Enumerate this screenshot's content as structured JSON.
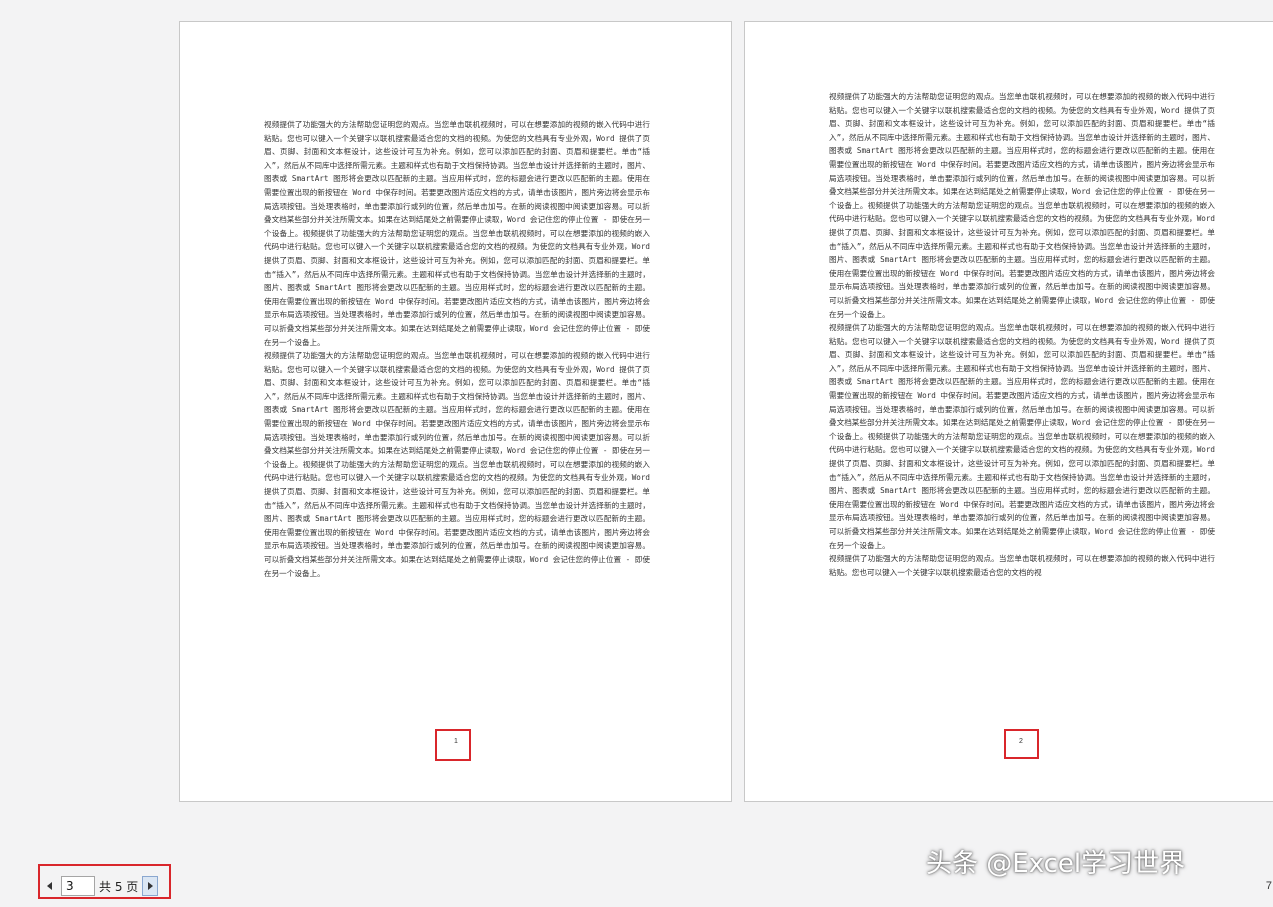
{
  "document": {
    "pages": [
      {
        "number": "1",
        "paragraphs": [
          "视频提供了功能强大的方法帮助您证明您的观点。当您单击联机视频时，可以在想要添加的视频的嵌入代码中进行粘贴。您也可以键入一个关键字以联机搜索最适合您的文档的视频。为使您的文档具有专业外观，Word 提供了页眉、页脚、封面和文本框设计，这些设计可互为补充。例如，您可以添加匹配的封面、页眉和提要栏。单击“插入”，然后从不同库中选择所需元素。主题和样式也有助于文档保持协调。当您单击设计并选择新的主题时，图片、图表或 SmartArt 图形将会更改以匹配新的主题。当应用样式时，您的标题会进行更改以匹配新的主题。使用在需要位置出现的新按钮在 Word 中保存时间。若要更改图片适应文档的方式，请单击该图片，图片旁边将会显示布局选项按钮。当处理表格时，单击要添加行或列的位置，然后单击加号。在新的阅读视图中阅读更加容易。可以折叠文档某些部分并关注所需文本。如果在达到结尾处之前需要停止读取，Word 会记住您的停止位置 - 即使在另一个设备上。视频提供了功能强大的方法帮助您证明您的观点。当您单击联机视频时，可以在想要添加的视频的嵌入代码中进行粘贴。您也可以键入一个关键字以联机搜索最适合您的文档的视频。为使您的文档具有专业外观，Word 提供了页眉、页脚、封面和文本框设计，这些设计可互为补充。例如，您可以添加匹配的封面、页眉和提要栏。单击“插入”，然后从不同库中选择所需元素。主题和样式也有助于文档保持协调。当您单击设计并选择新的主题时，图片、图表或 SmartArt 图形将会更改以匹配新的主题。当应用样式时，您的标题会进行更改以匹配新的主题。使用在需要位置出现的新按钮在 Word 中保存时间。若要更改图片适应文档的方式，请单击该图片，图片旁边将会显示布局选项按钮。当处理表格时，单击要添加行或列的位置，然后单击加号。在新的阅读视图中阅读更加容易。可以折叠文档某些部分并关注所需文本。如果在达到结尾处之前需要停止读取，Word 会记住您的停止位置 - 即使在另一个设备上。",
          "视频提供了功能强大的方法帮助您证明您的观点。当您单击联机视频时，可以在想要添加的视频的嵌入代码中进行粘贴。您也可以键入一个关键字以联机搜索最适合您的文档的视频。为使您的文档具有专业外观，Word 提供了页眉、页脚、封面和文本框设计，这些设计可互为补充。例如，您可以添加匹配的封面、页眉和提要栏。单击“插入”，然后从不同库中选择所需元素。主题和样式也有助于文档保持协调。当您单击设计并选择新的主题时，图片、图表或 SmartArt 图形将会更改以匹配新的主题。当应用样式时，您的标题会进行更改以匹配新的主题。使用在需要位置出现的新按钮在 Word 中保存时间。若要更改图片适应文档的方式，请单击该图片，图片旁边将会显示布局选项按钮。当处理表格时，单击要添加行或列的位置，然后单击加号。在新的阅读视图中阅读更加容易。可以折叠文档某些部分并关注所需文本。如果在达到结尾处之前需要停止读取，Word 会记住您的停止位置 - 即使在另一个设备上。视频提供了功能强大的方法帮助您证明您的观点。当您单击联机视频时，可以在想要添加的视频的嵌入代码中进行粘贴。您也可以键入一个关键字以联机搜索最适合您的文档的视频。为使您的文档具有专业外观，Word 提供了页眉、页脚、封面和文本框设计，这些设计可互为补充。例如，您可以添加匹配的封面、页眉和提要栏。单击“插入”，然后从不同库中选择所需元素。主题和样式也有助于文档保持协调。当您单击设计并选择新的主题时，图片、图表或 SmartArt 图形将会更改以匹配新的主题。当应用样式时，您的标题会进行更改以匹配新的主题。使用在需要位置出现的新按钮在 Word 中保存时间。若要更改图片适应文档的方式，请单击该图片，图片旁边将会显示布局选项按钮。当处理表格时，单击要添加行或列的位置，然后单击加号。在新的阅读视图中阅读更加容易。可以折叠文档某些部分并关注所需文本。如果在达到结尾处之前需要停止读取，Word 会记住您的停止位置 - 即使在另一个设备上。"
        ]
      },
      {
        "number": "2",
        "paragraphs": [
          "视频提供了功能强大的方法帮助您证明您的观点。当您单击联机视频时，可以在想要添加的视频的嵌入代码中进行粘贴。您也可以键入一个关键字以联机搜索最适合您的文档的视频。为使您的文档具有专业外观，Word 提供了页眉、页脚、封面和文本框设计，这些设计可互为补充。例如，您可以添加匹配的封面、页眉和提要栏。单击“插入”，然后从不同库中选择所需元素。主题和样式也有助于文档保持协调。当您单击设计并选择新的主题时，图片、图表或 SmartArt 图形将会更改以匹配新的主题。当应用样式时，您的标题会进行更改以匹配新的主题。使用在需要位置出现的新按钮在 Word 中保存时间。若要更改图片适应文档的方式，请单击该图片，图片旁边将会显示布局选项按钮。当处理表格时，单击要添加行或列的位置，然后单击加号。在新的阅读视图中阅读更加容易。可以折叠文档某些部分并关注所需文本。如果在达到结尾处之前需要停止读取，Word 会记住您的停止位置 - 即使在另一个设备上。视频提供了功能强大的方法帮助您证明您的观点。当您单击联机视频时，可以在想要添加的视频的嵌入代码中进行粘贴。您也可以键入一个关键字以联机搜索最适合您的文档的视频。为使您的文档具有专业外观，Word 提供了页眉、页脚、封面和文本框设计，这些设计可互为补充。例如，您可以添加匹配的封面、页眉和提要栏。单击“插入”，然后从不同库中选择所需元素。主题和样式也有助于文档保持协调。当您单击设计并选择新的主题时，图片、图表或 SmartArt 图形将会更改以匹配新的主题。当应用样式时，您的标题会进行更改以匹配新的主题。使用在需要位置出现的新按钮在 Word 中保存时间。若要更改图片适应文档的方式，请单击该图片，图片旁边将会显示布局选项按钮。当处理表格时，单击要添加行或列的位置，然后单击加号。在新的阅读视图中阅读更加容易。可以折叠文档某些部分并关注所需文本。如果在达到结尾处之前需要停止读取，Word 会记住您的停止位置 - 即使在另一个设备上。",
          "视频提供了功能强大的方法帮助您证明您的观点。当您单击联机视频时，可以在想要添加的视频的嵌入代码中进行粘贴。您也可以键入一个关键字以联机搜索最适合您的文档的视频。为使您的文档具有专业外观，Word 提供了页眉、页脚、封面和文本框设计，这些设计可互为补充。例如，您可以添加匹配的封面、页眉和提要栏。单击“插入”，然后从不同库中选择所需元素。主题和样式也有助于文档保持协调。当您单击设计并选择新的主题时，图片、图表或 SmartArt 图形将会更改以匹配新的主题。当应用样式时，您的标题会进行更改以匹配新的主题。使用在需要位置出现的新按钮在 Word 中保存时间。若要更改图片适应文档的方式，请单击该图片，图片旁边将会显示布局选项按钮。当处理表格时，单击要添加行或列的位置，然后单击加号。在新的阅读视图中阅读更加容易。可以折叠文档某些部分并关注所需文本。如果在达到结尾处之前需要停止读取，Word 会记住您的停止位置 - 即使在另一个设备上。视频提供了功能强大的方法帮助您证明您的观点。当您单击联机视频时，可以在想要添加的视频的嵌入代码中进行粘贴。您也可以键入一个关键字以联机搜索最适合您的文档的视频。为使您的文档具有专业外观，Word 提供了页眉、页脚、封面和文本框设计，这些设计可互为补充。例如，您可以添加匹配的封面、页眉和提要栏。单击“插入”，然后从不同库中选择所需元素。主题和样式也有助于文档保持协调。当您单击设计并选择新的主题时，图片、图表或 SmartArt 图形将会更改以匹配新的主题。当应用样式时，您的标题会进行更改以匹配新的主题。使用在需要位置出现的新按钮在 Word 中保存时间。若要更改图片适应文档的方式，请单击该图片，图片旁边将会显示布局选项按钮。当处理表格时，单击要添加行或列的位置，然后单击加号。在新的阅读视图中阅读更加容易。可以折叠文档某些部分并关注所需文本。如果在达到结尾处之前需要停止读取，Word 会记住您的停止位置 - 即使在另一个设备上。",
          "视频提供了功能强大的方法帮助您证明您的观点。当您单击联机视频时，可以在想要添加的视频的嵌入代码中进行粘贴。您也可以键入一个关键字以联机搜索最适合您的文档的视"
        ]
      }
    ]
  },
  "pager": {
    "prev_icon": "triangle-left-icon",
    "current_page": "3",
    "total_label": "共 5 页",
    "next_icon": "triangle-right-icon"
  },
  "watermark": {
    "text": "头条 @Excel学习世界"
  },
  "zoom_fragment": "7",
  "colors": {
    "highlight": "#d9262b",
    "background": "#f3f3f4",
    "page": "#ffffff"
  }
}
